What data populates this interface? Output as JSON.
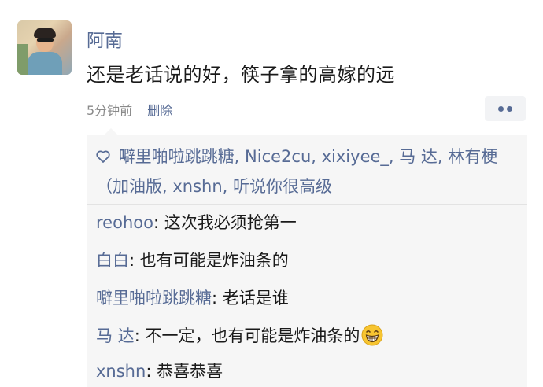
{
  "post": {
    "author": "阿南",
    "content": "还是老话说的好，筷子拿的高嫁的远",
    "time": "5分钟前",
    "delete_label": "删除"
  },
  "likes": {
    "icon": "heart-outline-icon",
    "text": "噼里啪啦跳跳糖, Nice2cu, xixiyee_, 马 达, 林有梗（加油版, xnshn, 听说你很高级"
  },
  "comments": [
    {
      "name": "reohoo",
      "text": ": 这次我必须抢第一"
    },
    {
      "name": "白白",
      "text": ": 也有可能是炸油条的"
    },
    {
      "name": "噼里啪啦跳跳糖",
      "text": ": 老话是谁"
    },
    {
      "name": "马 达",
      "text": ": 不一定，也有可能是炸油条的",
      "emoji": "grinning-face-icon"
    },
    {
      "name": "xnshn",
      "text": ": 恭喜恭喜"
    }
  ],
  "colors": {
    "link": "#576b95",
    "panel_bg": "#f6f6f6",
    "meta_gray": "#8a8a8a"
  }
}
